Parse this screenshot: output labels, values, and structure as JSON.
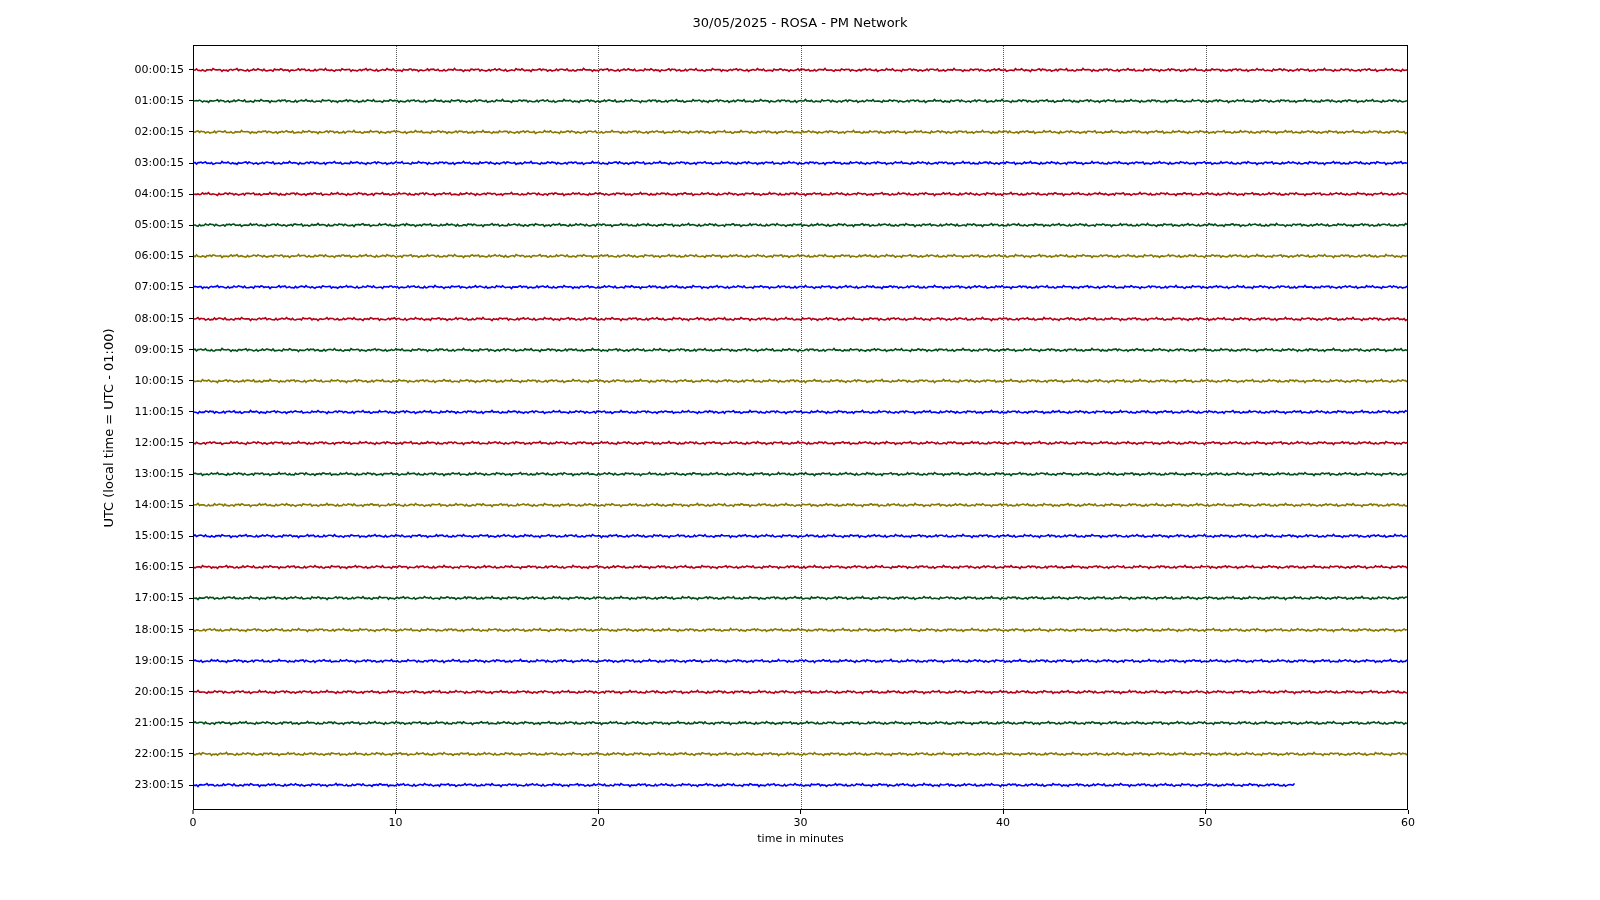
{
  "title": "30/05/2025 - ROSA - PM Network",
  "y_axis": {
    "label": "UTC (local time = UTC - 01:00)"
  },
  "x_axis": {
    "label": "time in minutes",
    "ticks": [
      "0",
      "10",
      "20",
      "30",
      "40",
      "50",
      "60"
    ]
  },
  "traces": [
    {
      "label": "00:00:15",
      "color": "#b40018",
      "level": 1
    },
    {
      "label": "01:00:15",
      "color": "#00501a",
      "level": 1
    },
    {
      "label": "02:00:15",
      "color": "#887800",
      "level": 1
    },
    {
      "label": "03:00:15",
      "color": "#0000ff",
      "level": 1
    },
    {
      "label": "04:00:15",
      "color": "#b40018",
      "level": 1
    },
    {
      "label": "05:00:15",
      "color": "#00501a",
      "level": 1
    },
    {
      "label": "06:00:15",
      "color": "#887800",
      "level": 1
    },
    {
      "label": "07:00:15",
      "color": "#0000ff",
      "level": 1
    },
    {
      "label": "08:00:15",
      "color": "#b40018",
      "level": 1
    },
    {
      "label": "09:00:15",
      "color": "#00501a",
      "level": 1
    },
    {
      "label": "10:00:15",
      "color": "#887800",
      "level": 1
    },
    {
      "label": "11:00:15",
      "color": "#0000ff",
      "level": 1
    },
    {
      "label": "12:00:15",
      "color": "#b40018",
      "level": 1
    },
    {
      "label": "13:00:15",
      "color": "#00501a",
      "level": 1
    },
    {
      "label": "14:00:15",
      "color": "#887800",
      "level": 1
    },
    {
      "label": "15:00:15",
      "color": "#0000ff",
      "level": 1
    },
    {
      "label": "16:00:15",
      "color": "#b40018",
      "level": 1
    },
    {
      "label": "17:00:15",
      "color": "#00501a",
      "level": 1
    },
    {
      "label": "18:00:15",
      "color": "#887800",
      "level": 1
    },
    {
      "label": "19:00:15",
      "color": "#0000ff",
      "level": 1
    },
    {
      "label": "20:00:15",
      "color": "#b40018",
      "level": 1
    },
    {
      "label": "21:00:15",
      "color": "#00501a",
      "level": 1
    },
    {
      "label": "22:00:15",
      "color": "#887800",
      "level": 1
    },
    {
      "label": "23:00:15",
      "color": "#0000ff",
      "level": 0.908
    }
  ]
}
